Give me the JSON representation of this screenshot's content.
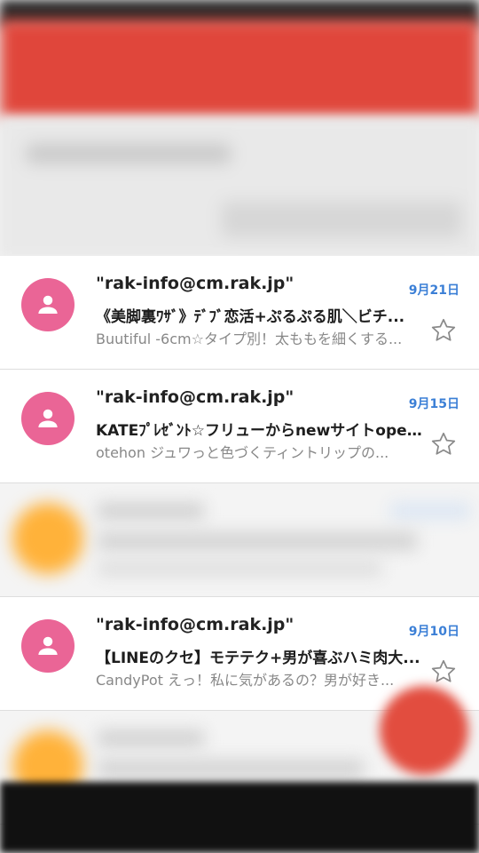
{
  "accent": "#e0463b",
  "date_color": "#3b7fd6",
  "avatar_color": "#ea6596",
  "emails": [
    {
      "sender": "\"rak-info@cm.rak.jp\"",
      "date": "9月21日",
      "subject": "《美脚裏ﾜｻﾞ》ﾃﾞﾌﾞ恋活+ぷるぷる肌＼ビチ...",
      "snippet": "Buutiful -6cm☆タイプ別！太ももを細くする...",
      "avatar_icon": "person-icon",
      "star_icon": "star-outline-icon"
    },
    {
      "sender": "\"rak-info@cm.rak.jp\"",
      "date": "9月15日",
      "subject": "KATEﾌﾟﾚｾﾞﾝﾄ☆フリューからnewサイトope...",
      "snippet": "otehon ジュワっと色づくティントリップの...",
      "avatar_icon": "person-icon",
      "star_icon": "star-outline-icon"
    },
    {
      "sender": "\"rak-info@cm.rak.jp\"",
      "date": "9月10日",
      "subject": "【LINEのクセ】モテテク+男が喜ぶハミ肉大...",
      "snippet": "CandyPot えっ！私に気があるの？男が好き...",
      "avatar_icon": "person-icon",
      "star_icon": "star-outline-icon"
    }
  ]
}
